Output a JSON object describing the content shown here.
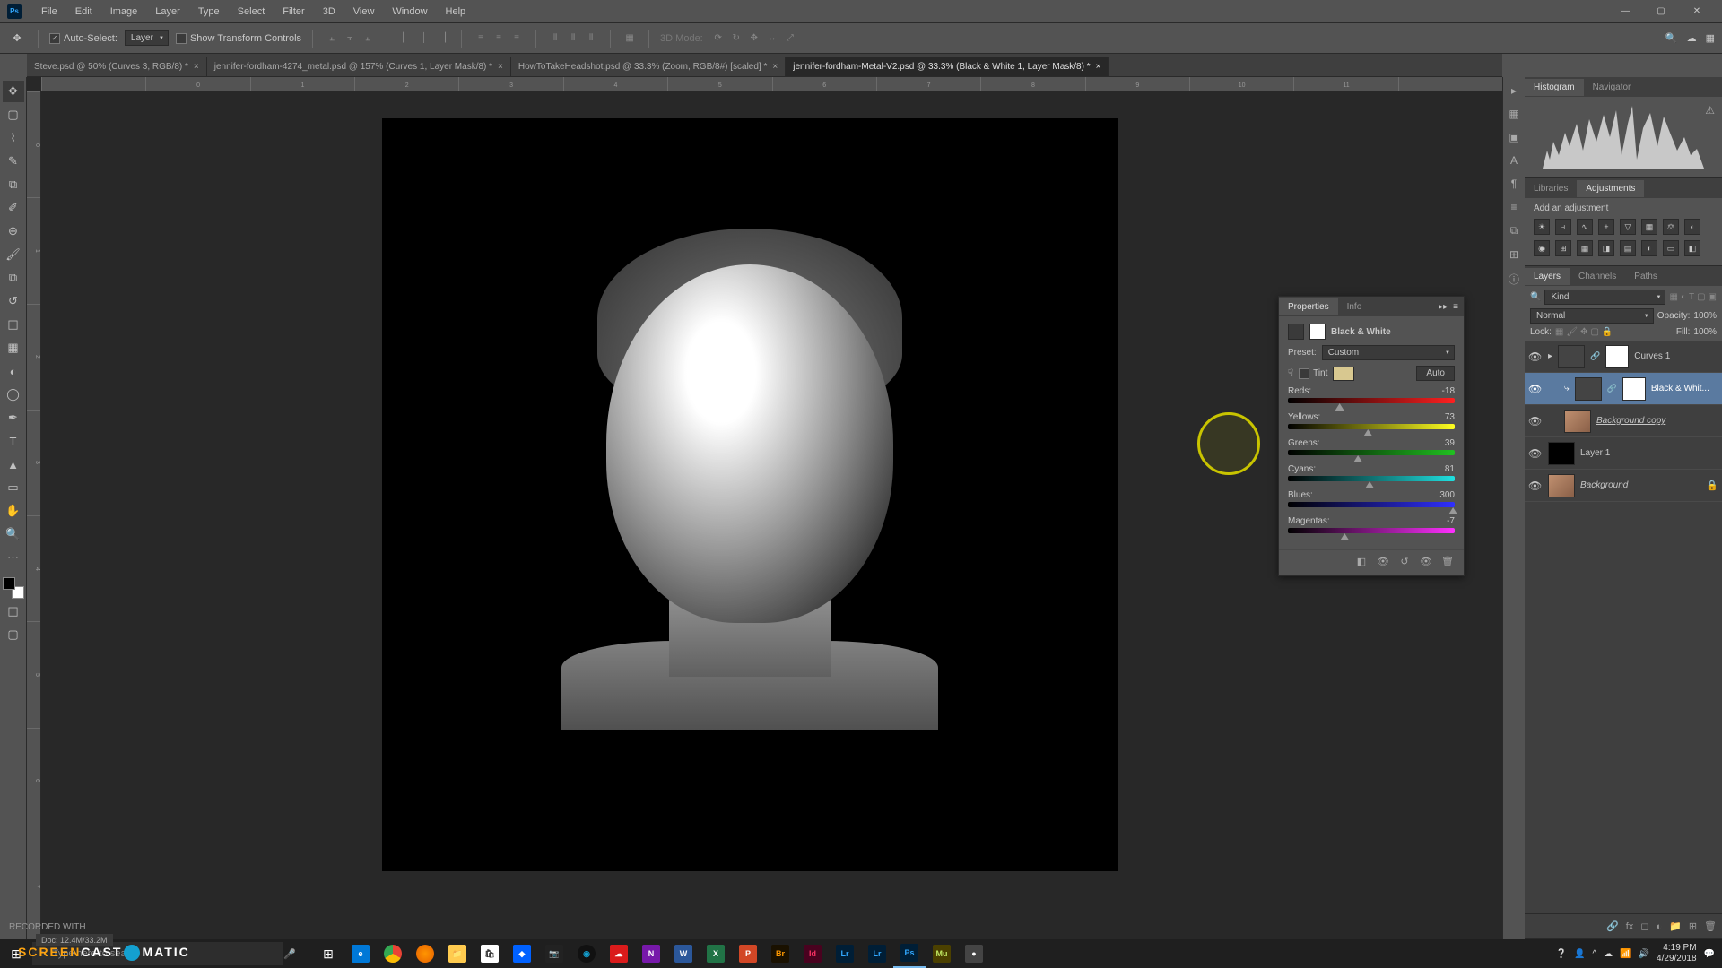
{
  "menu": {
    "items": [
      "File",
      "Edit",
      "Image",
      "Layer",
      "Type",
      "Select",
      "Filter",
      "3D",
      "View",
      "Window",
      "Help"
    ]
  },
  "options": {
    "auto_select": "Auto-Select:",
    "layer_dd": "Layer",
    "show_transform": "Show Transform Controls",
    "mode_3d": "3D Mode:"
  },
  "tabs": [
    {
      "label": "Steve.psd @ 50% (Curves 3, RGB/8) *",
      "active": false
    },
    {
      "label": "jennifer-fordham-4274_metal.psd @ 157% (Curves 1, Layer Mask/8) *",
      "active": false
    },
    {
      "label": "HowToTakeHeadshot.psd @ 33.3% (Zoom, RGB/8#) [scaled] *",
      "active": false
    },
    {
      "label": "jennifer-fordham-Metal-V2.psd @ 33.3% (Black & White 1, Layer Mask/8) *",
      "active": true
    }
  ],
  "ruler_h": [
    "",
    "0",
    "1",
    "2",
    "3",
    "4",
    "5",
    "6",
    "7",
    "8",
    "9",
    "10",
    "11",
    ""
  ],
  "ruler_v": [
    "0",
    "1",
    "2",
    "3",
    "4",
    "5",
    "6",
    "7"
  ],
  "histogram": {
    "tab1": "Histogram",
    "tab2": "Navigator"
  },
  "adjustments": {
    "tab1": "Libraries",
    "tab2": "Adjustments",
    "label": "Add an adjustment"
  },
  "properties": {
    "tab1": "Properties",
    "tab2": "Info",
    "title": "Black & White",
    "preset_lbl": "Preset:",
    "preset_val": "Custom",
    "tint": "Tint",
    "auto": "Auto",
    "sliders": [
      {
        "name": "Reds:",
        "value": "-18",
        "class": "grad-red",
        "pos": 31
      },
      {
        "name": "Yellows:",
        "value": "73",
        "class": "grad-yellow",
        "pos": 48
      },
      {
        "name": "Greens:",
        "value": "39",
        "class": "grad-green",
        "pos": 42
      },
      {
        "name": "Cyans:",
        "value": "81",
        "class": "grad-cyan",
        "pos": 49
      },
      {
        "name": "Blues:",
        "value": "300",
        "class": "grad-blue",
        "pos": 99
      },
      {
        "name": "Magentas:",
        "value": "-7",
        "class": "grad-magenta",
        "pos": 34
      }
    ]
  },
  "layers": {
    "tab1": "Layers",
    "tab2": "Channels",
    "tab3": "Paths",
    "kind": "Kind",
    "blend": "Normal",
    "opacity_lbl": "Opacity:",
    "opacity": "100%",
    "lock_lbl": "Lock:",
    "fill_lbl": "Fill:",
    "fill": "100%",
    "items": [
      {
        "name": "Curves 1",
        "type": "adj",
        "sel": false,
        "indent": 0
      },
      {
        "name": "Black & Whit...",
        "type": "adj",
        "sel": true,
        "indent": 1
      },
      {
        "name": "Background copy",
        "type": "img",
        "sel": false,
        "indent": 1,
        "italic": true
      },
      {
        "name": "Layer 1",
        "type": "black",
        "sel": false,
        "indent": 0
      },
      {
        "name": "Background",
        "type": "img",
        "sel": false,
        "indent": 0,
        "italic": true,
        "locked": true
      }
    ]
  },
  "status": {
    "recorded": "RECORDED WITH",
    "doc": "Doc: 12.4M/33.2M"
  },
  "taskbar": {
    "search": "Type here to search",
    "time": "4:19 PM",
    "date": "4/29/2018"
  }
}
